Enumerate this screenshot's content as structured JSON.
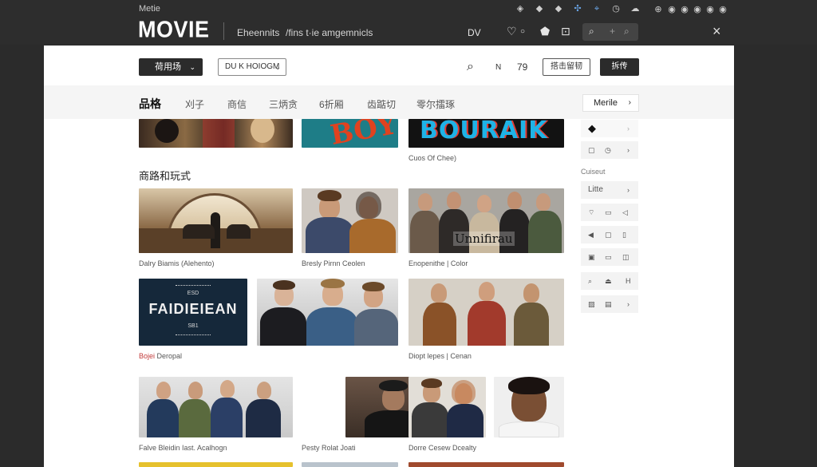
{
  "window": {
    "app_name": "Metie",
    "logo": "MOVIE",
    "nav_links": [
      "Eheennits",
      "/fins t·ie amgemnicls"
    ],
    "dv_label": "DV",
    "system_icons": [
      "diamond-icon",
      "diamond-icon",
      "diamond-icon",
      "target-icon",
      "crosshair-icon",
      "timer-icon",
      "cloud-icon"
    ],
    "system_right_icons": [
      "grid-dot-icon",
      "dot-icon",
      "dot-icon",
      "dot-icon",
      "dot-icon",
      "dot-icon"
    ],
    "close_label": "×"
  },
  "toolbar": {
    "dropdown_label": "荷用场",
    "filter_label": "DU K HOIOGM",
    "search_icon": "search-icon",
    "n_label": "N",
    "num_label": "79",
    "action_outline_label": "搭击留韧",
    "action_dark_label": "拆传"
  },
  "tabs": [
    "品格",
    "刈子",
    "商信",
    "三炳贪",
    "6折厢",
    "齿踮切",
    "零尔擂琢"
  ],
  "tab_button": "Merile",
  "captions": {
    "top_row": "Cuos Of Chee)",
    "row1": [
      "Dalry Biamis (Alehento)",
      "Bresly Pirnn Ceolen",
      "Enopenithe | Color"
    ],
    "row2_prefix": "Bojei",
    "row2_first": " Deropal",
    "row2_third": "Diopt lepes | Cenan",
    "row3": [
      "Falve Bleidin Iast. Acalhogn",
      "Pesty Rolat Joati",
      "Dorre Cesew Dcealty"
    ]
  },
  "section_title": "商路和玩式",
  "poster_texts": {
    "poster_a": "BOY",
    "poster_b": "BOURAIK",
    "poster_c": "FAIDIEIEAN",
    "poster_c_top": "ESD",
    "poster_c_bottom": "SB1",
    "poster_d": "Unnifirau"
  },
  "sidebar": {
    "label": "Cuiseut",
    "lite_label": "Litte",
    "rows": [
      [
        "arrow-left-icon",
        "chevron-right-icon"
      ],
      [
        "square-icon",
        "clock-icon",
        "chevron-right-icon"
      ],
      [
        "wifi-icon",
        "tv-icon",
        "speaker-icon"
      ],
      [
        "volume-icon",
        "square-icon",
        "bracket-icon"
      ],
      [
        "image-icon",
        "square-icon",
        "window-icon"
      ],
      [
        "search-icon",
        "cast-icon",
        "letter-h-icon"
      ],
      [
        "picture-icon",
        "box-icon",
        "chevron-right-icon"
      ]
    ],
    "row_glyphs": [
      [
        "◆",
        "›"
      ],
      [
        "▢",
        "◷",
        "›"
      ],
      [
        "⌔",
        "▭",
        "◁"
      ],
      [
        "◀",
        "▢",
        "▯"
      ],
      [
        "▣",
        "▭",
        "◫"
      ],
      [
        "⌕",
        "⏏",
        "H"
      ],
      [
        "▨",
        "▤",
        "›"
      ]
    ]
  },
  "colors": {
    "topbar": "#2d2d2d",
    "panel": "#ffffff",
    "accent_red": "#c23b3b"
  }
}
